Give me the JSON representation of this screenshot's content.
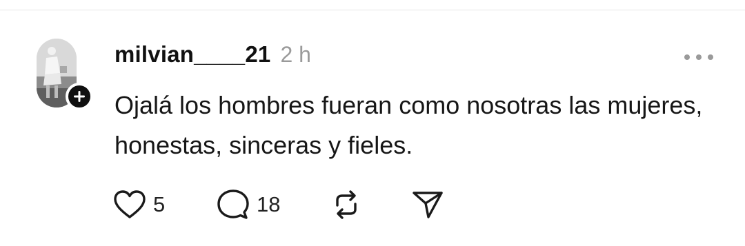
{
  "post": {
    "username": "milvian____21",
    "timestamp": "2 h",
    "text": "Ojalá los hombres fueran como nosotras las mujeres, honestas, sinceras y fieles.",
    "likes": "5",
    "replies": "18"
  },
  "icons": {
    "follow": "plus-icon",
    "more": "more-horizontal-icon",
    "like": "heart-icon",
    "reply": "speech-bubble-icon",
    "repost": "repost-icon",
    "share": "send-icon"
  },
  "colors": {
    "text": "#111111",
    "muted": "#9a9a9a",
    "badge": "#101010"
  }
}
